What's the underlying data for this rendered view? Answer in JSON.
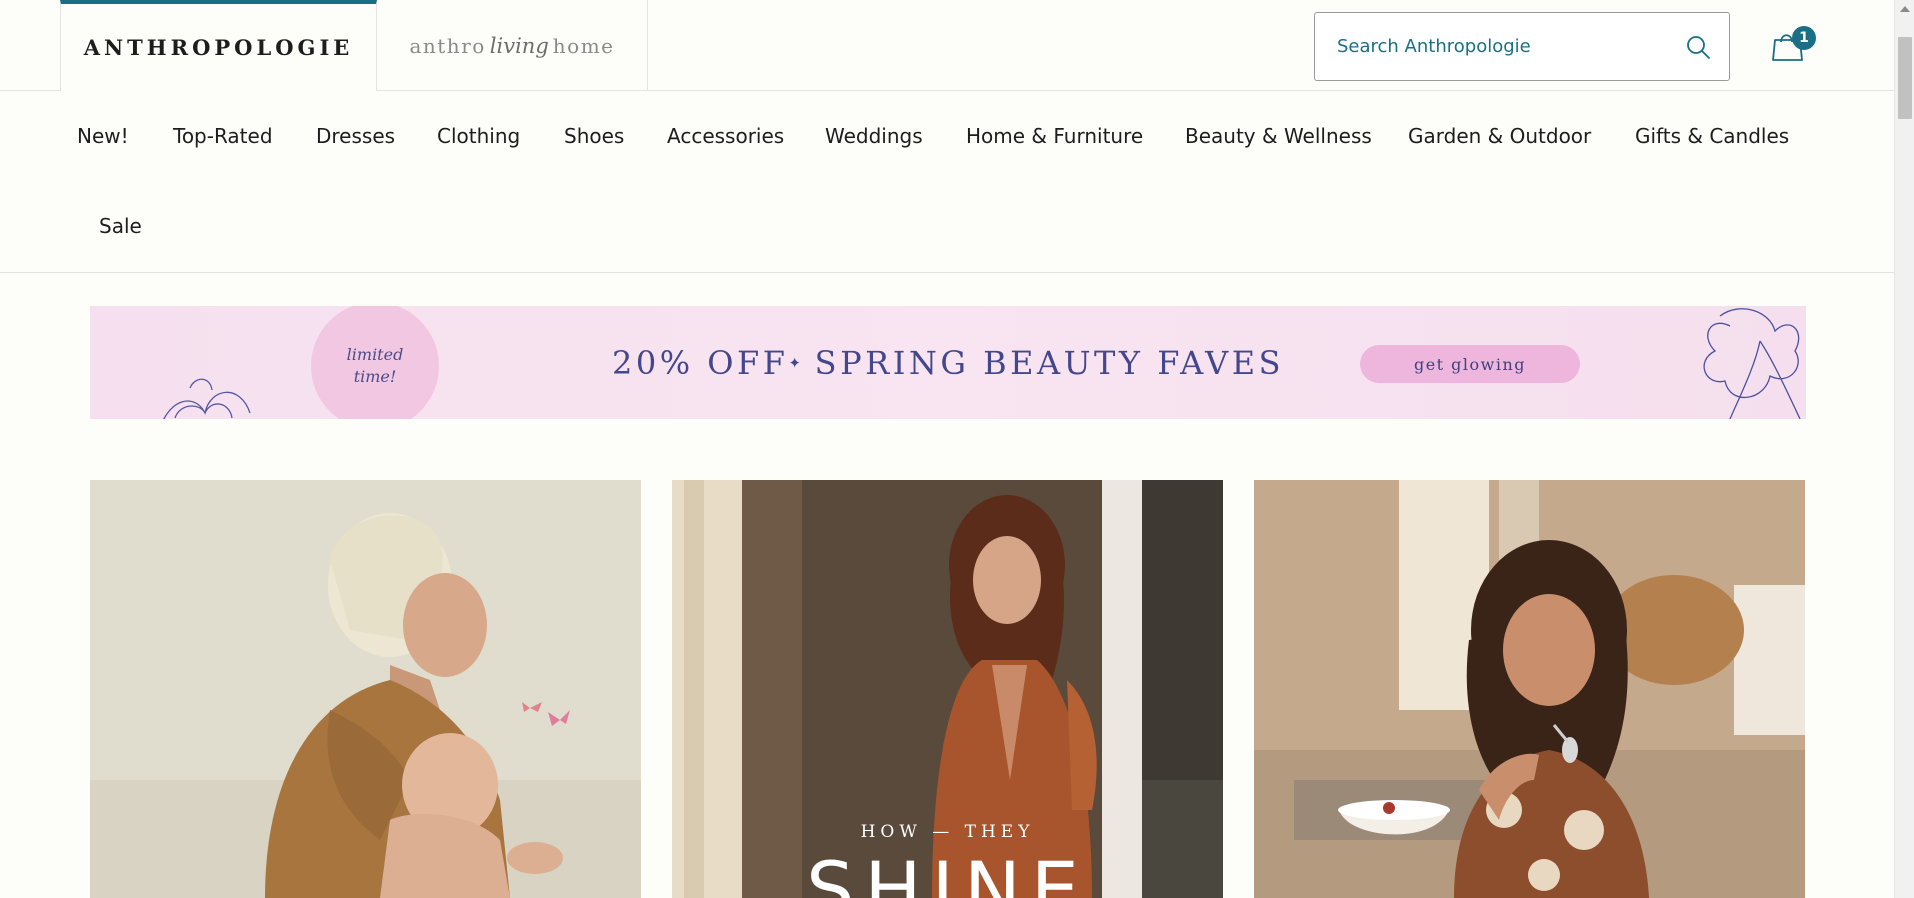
{
  "header": {
    "brand_primary": "ANTHROPOLOGIE",
    "brand_secondary_left": "anthro",
    "brand_secondary_script": "living",
    "brand_secondary_right": "home",
    "search_placeholder": "Search Anthropologie",
    "cart_count": "1"
  },
  "nav": {
    "items": [
      "New!",
      "Top-Rated",
      "Dresses",
      "Clothing",
      "Shoes",
      "Accessories",
      "Weddings",
      "Home & Furniture",
      "Beauty & Wellness",
      "Garden & Outdoor",
      "Gifts & Candles",
      "Sale"
    ]
  },
  "promo": {
    "badge_line1": "limited",
    "badge_line2": "time!",
    "headline_part1": "20% OFF",
    "headline_symbol": "✦",
    "headline_part2": "SPRING BEAUTY FAVES",
    "cta": "get glowing"
  },
  "tiles": [
    {
      "image": "mother-and-baby-with-butterflies"
    },
    {
      "image": "woman-in-rust-dress-by-mirror",
      "kicker": "HOW — THEY",
      "title": "SHINE"
    },
    {
      "image": "woman-with-bowl-in-floral-outfit"
    }
  ],
  "colors": {
    "accent": "#1a6f86",
    "background": "#fdfdf9",
    "promo_bg": "#f6e0ef",
    "promo_text": "#44478c"
  }
}
